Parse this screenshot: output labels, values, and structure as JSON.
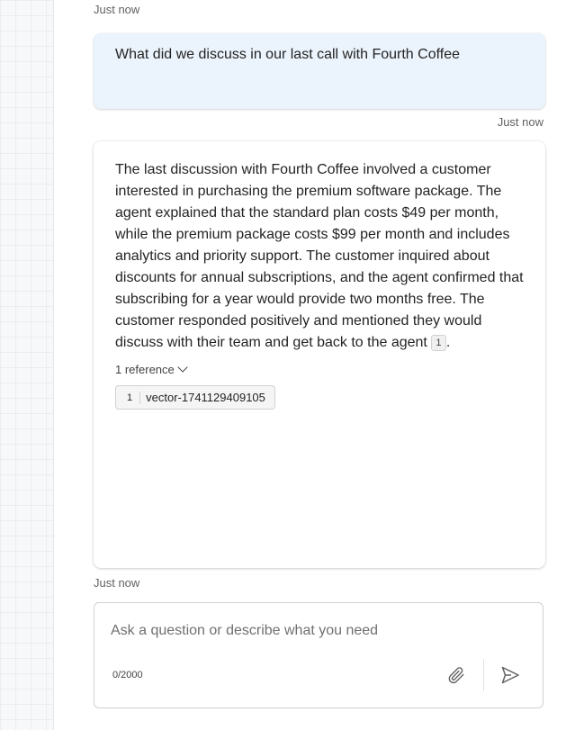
{
  "timestamps": {
    "top": "Just now",
    "user": "Just now",
    "bottom": "Just now"
  },
  "user_message": {
    "text": "What did we discuss in our last call with Fourth Coffee"
  },
  "bot_message": {
    "text": "The last discussion with Fourth Coffee involved a customer interested in purchasing the premium software package. The agent explained that the standard plan costs $49 per month, while the premium package costs $99 per month and includes analytics and priority support. The customer inquired about discounts for annual subscriptions, and the agent confirmed that subscribing for a year would provide two months free. The customer responded positively and mentioned they would discuss with their team and get back to the agent",
    "citation": "1",
    "end_punct": ".",
    "references_label": "1 reference",
    "references": [
      {
        "number": "1",
        "name": "vector-1741129409105"
      }
    ]
  },
  "composer": {
    "placeholder": "Ask a question or describe what you need",
    "char_count": "0/2000",
    "attach_icon": "paperclip-icon",
    "send_icon": "send-icon"
  }
}
